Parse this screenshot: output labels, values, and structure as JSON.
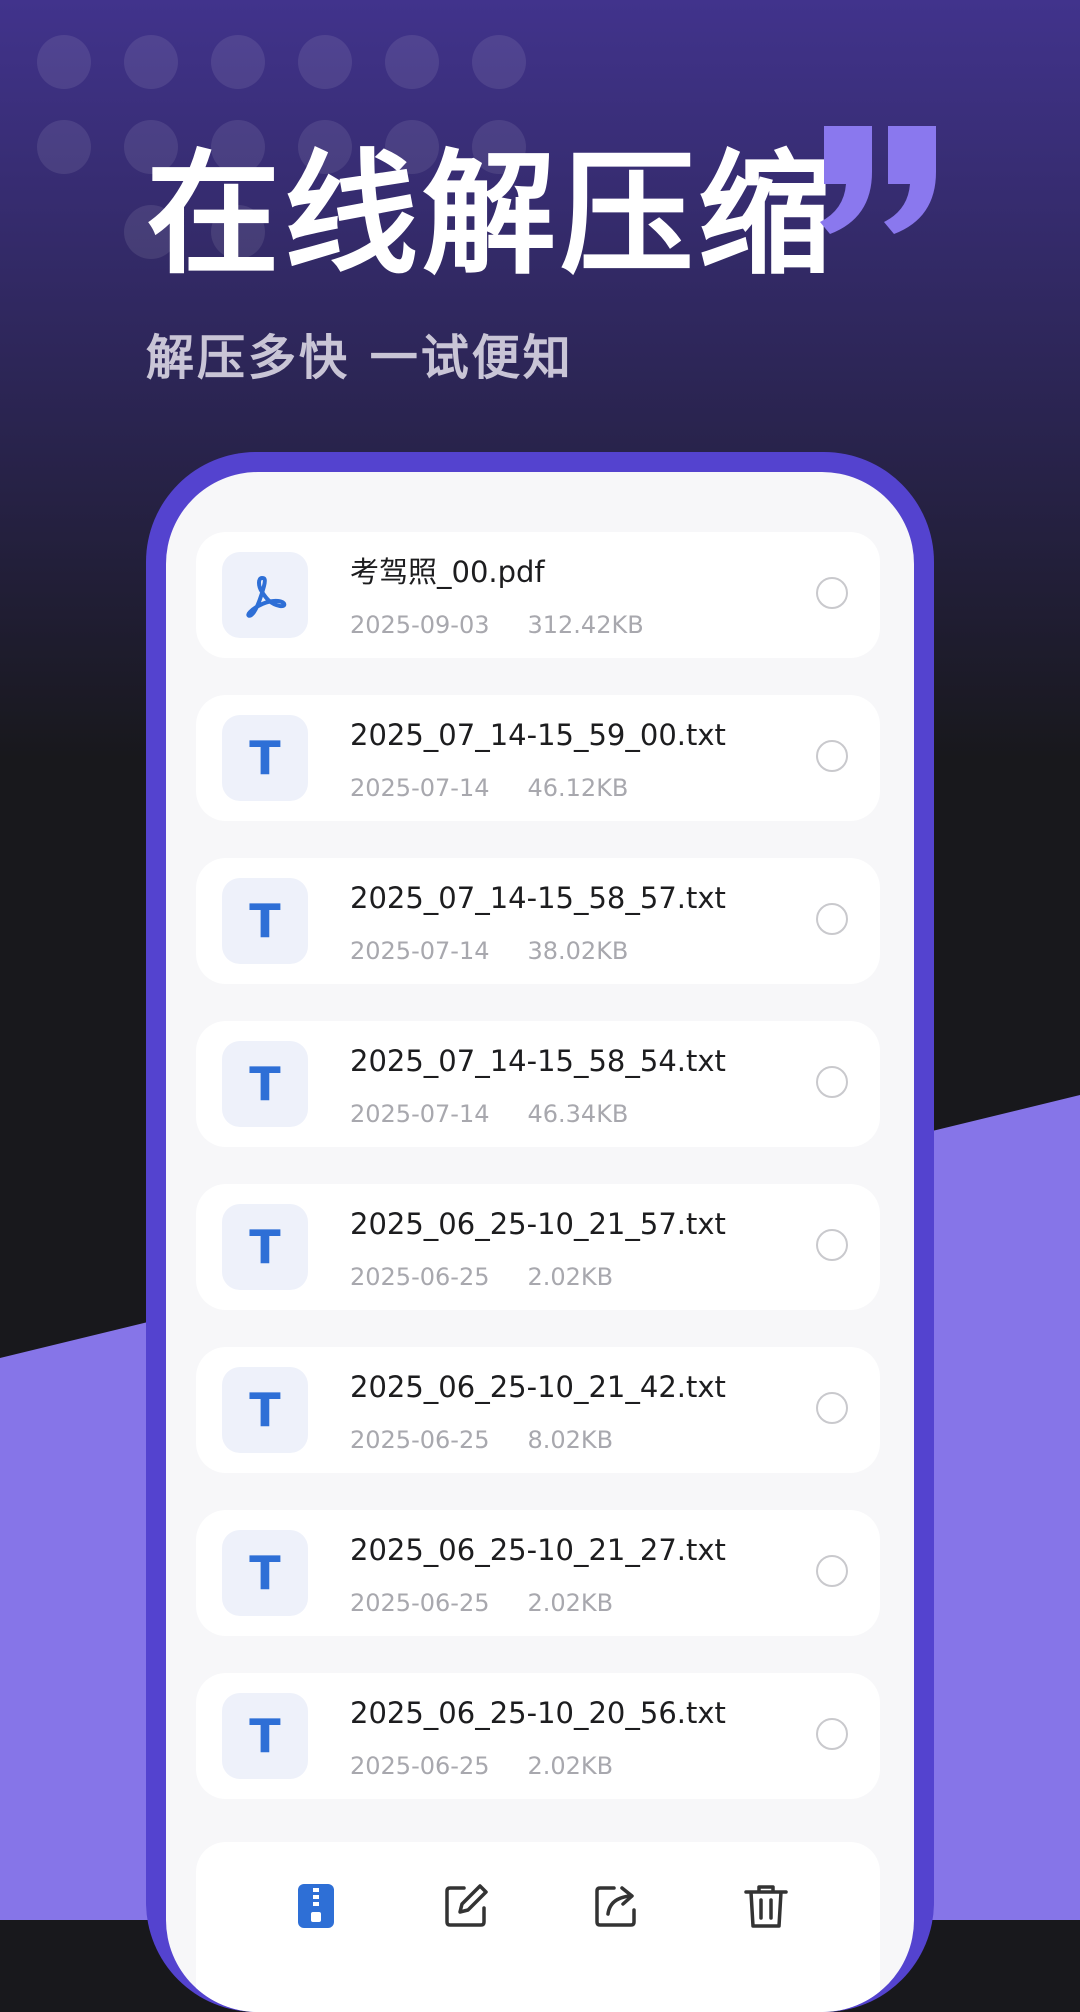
{
  "hero": {
    "title": "在线解压缩",
    "subtitle": "解压多快 一试便知"
  },
  "colors": {
    "accent_purple": "#5443cf",
    "light_purple": "#8675e8",
    "dark_bg": "#18181c",
    "file_icon_blue": "#2e6fd6"
  },
  "files": [
    {
      "name": "考驾照_00.pdf",
      "date": "2025-09-03",
      "size": "312.42KB",
      "icon": "pdf-icon",
      "selected": false
    },
    {
      "name": "2025_07_14-15_59_00.txt",
      "date": "2025-07-14",
      "size": "46.12KB",
      "icon": "txt-icon",
      "glyph": "T",
      "selected": false
    },
    {
      "name": "2025_07_14-15_58_57.txt",
      "date": "2025-07-14",
      "size": "38.02KB",
      "icon": "txt-icon",
      "glyph": "T",
      "selected": false
    },
    {
      "name": "2025_07_14-15_58_54.txt",
      "date": "2025-07-14",
      "size": "46.34KB",
      "icon": "txt-icon",
      "glyph": "T",
      "selected": false
    },
    {
      "name": "2025_06_25-10_21_57.txt",
      "date": "2025-06-25",
      "size": "2.02KB",
      "icon": "txt-icon",
      "glyph": "T",
      "selected": false
    },
    {
      "name": "2025_06_25-10_21_42.txt",
      "date": "2025-06-25",
      "size": "8.02KB",
      "icon": "txt-icon",
      "glyph": "T",
      "selected": false
    },
    {
      "name": "2025_06_25-10_21_27.txt",
      "date": "2025-06-25",
      "size": "2.02KB",
      "icon": "txt-icon",
      "glyph": "T",
      "selected": false
    },
    {
      "name": "2025_06_25-10_20_56.txt",
      "date": "2025-06-25",
      "size": "2.02KB",
      "icon": "txt-icon",
      "glyph": "T",
      "selected": false
    }
  ],
  "bottom_bar": {
    "buttons": [
      {
        "icon": "zip-icon"
      },
      {
        "icon": "edit-icon"
      },
      {
        "icon": "share-icon"
      },
      {
        "icon": "trash-icon"
      }
    ]
  }
}
